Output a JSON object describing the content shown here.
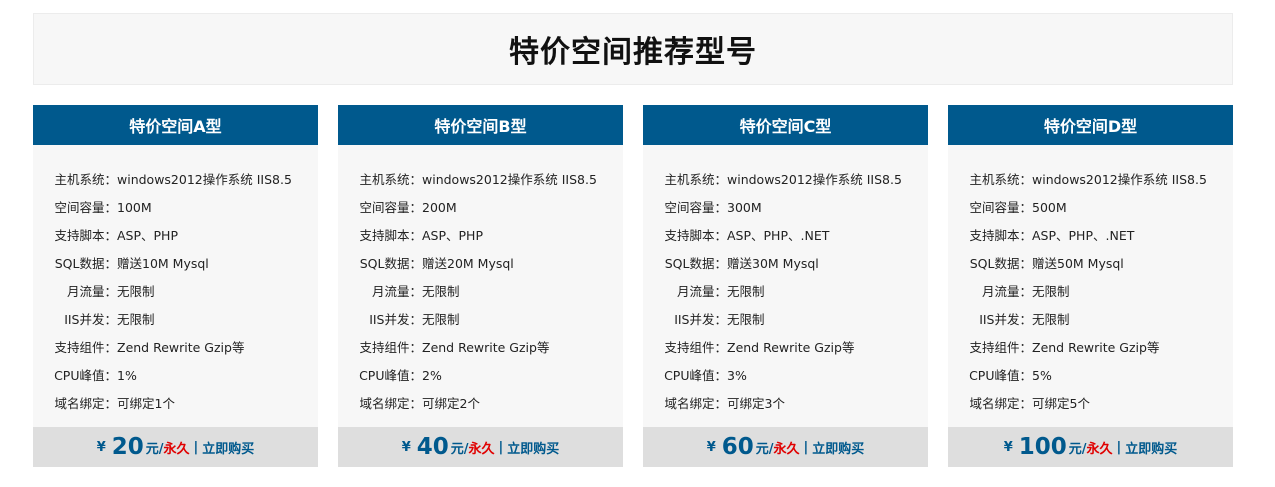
{
  "banner": {
    "title": "特价空间推荐型号"
  },
  "labels": {
    "os": "主机系统：",
    "space": "空间容量：",
    "script": "支持脚本：",
    "sql": "SQL数据：",
    "traffic": "月流量：",
    "iis": "IIS并发：",
    "components": "支持组件：",
    "cpu": "CPU峰值：",
    "domain": "域名绑定："
  },
  "price_labels": {
    "currency": "¥",
    "unit": "元/",
    "forever": "永久",
    "separator": "|",
    "buy": "立即购买"
  },
  "plans": [
    {
      "title": "特价空间A型",
      "os": "windows2012操作系统 IIS8.5",
      "space": "100M",
      "script": "ASP、PHP",
      "sql": "赠送10M Mysql",
      "traffic": "无限制",
      "iis": "无限制",
      "components": "Zend Rewrite Gzip等",
      "cpu": "1%",
      "domain": "可绑定1个",
      "price": "20"
    },
    {
      "title": "特价空间B型",
      "os": "windows2012操作系统 IIS8.5",
      "space": "200M",
      "script": "ASP、PHP",
      "sql": "赠送20M Mysql",
      "traffic": "无限制",
      "iis": "无限制",
      "components": "Zend Rewrite Gzip等",
      "cpu": "2%",
      "domain": "可绑定2个",
      "price": "40"
    },
    {
      "title": "特价空间C型",
      "os": "windows2012操作系统 IIS8.5",
      "space": "300M",
      "script": "ASP、PHP、.NET",
      "sql": "赠送30M Mysql",
      "traffic": "无限制",
      "iis": "无限制",
      "components": "Zend Rewrite Gzip等",
      "cpu": "3%",
      "domain": "可绑定3个",
      "price": "60"
    },
    {
      "title": "特价空间D型",
      "os": "windows2012操作系统 IIS8.5",
      "space": "500M",
      "script": "ASP、PHP、.NET",
      "sql": "赠送50M Mysql",
      "traffic": "无限制",
      "iis": "无限制",
      "components": "Zend Rewrite Gzip等",
      "cpu": "5%",
      "domain": "可绑定5个",
      "price": "100"
    }
  ]
}
